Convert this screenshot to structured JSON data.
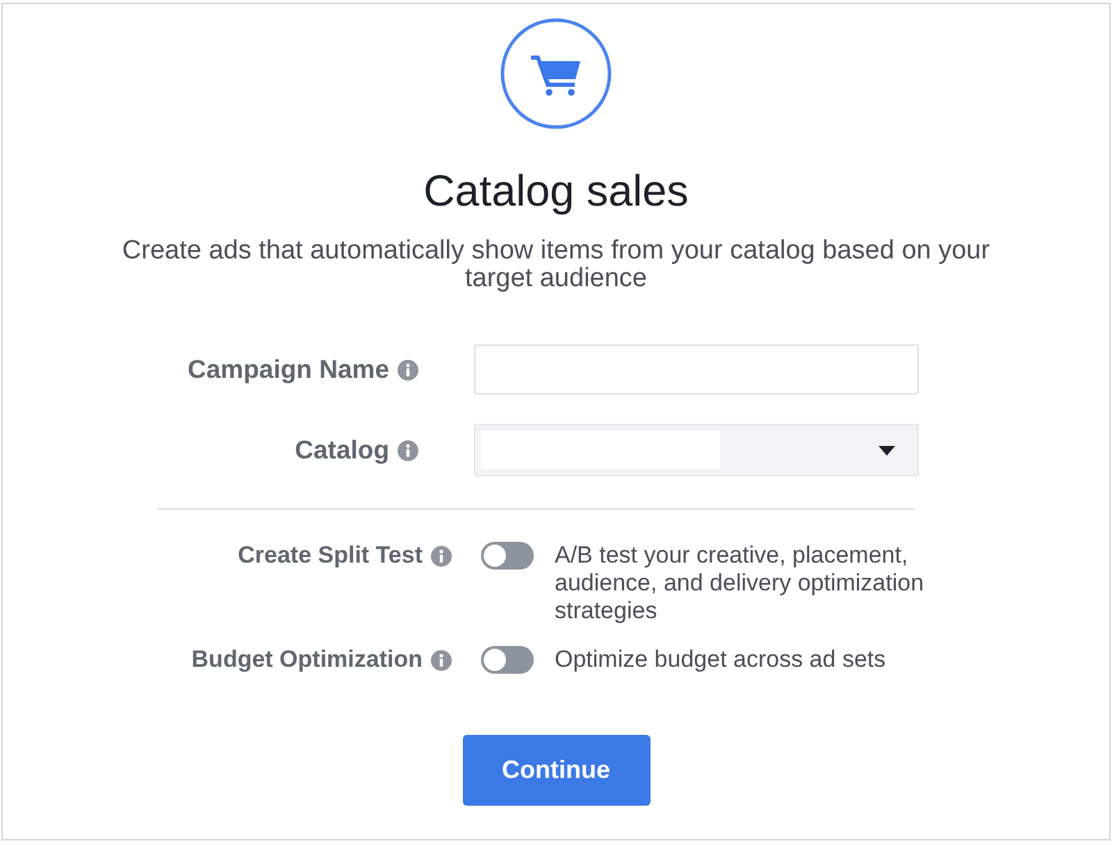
{
  "header": {
    "title": "Catalog sales",
    "description": "Create ads that automatically show items from your catalog based on your target audience"
  },
  "fields": [
    {
      "label": "Campaign Name",
      "kind": "text"
    },
    {
      "label": "Catalog",
      "kind": "select"
    }
  ],
  "toggles": [
    {
      "label": "Create Split Test",
      "on": false,
      "description": "A/B test your creative, placement, audience, and delivery optimization strategies"
    },
    {
      "label": "Budget Optimization",
      "on": false,
      "description": "Optimize budget across ad sets"
    }
  ],
  "primary_button": {
    "label": "Continue"
  }
}
